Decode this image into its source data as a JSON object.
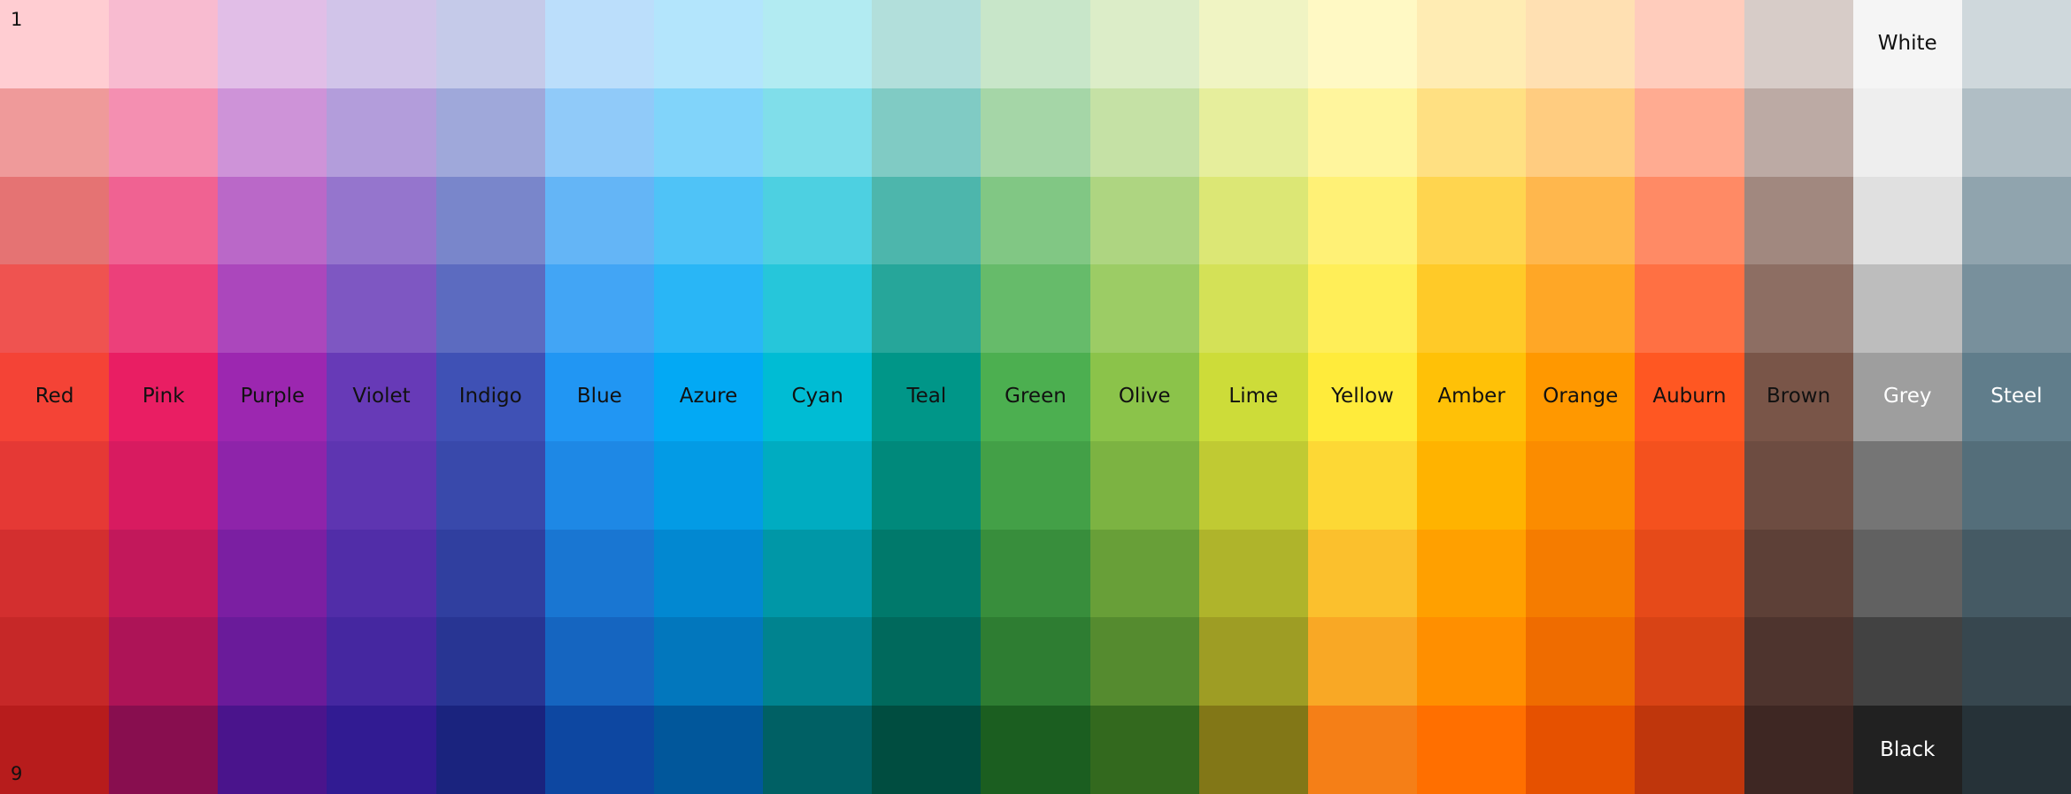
{
  "row_labels": {
    "first": "1",
    "last": "9"
  },
  "columns": [
    {
      "name": "Red",
      "label_row": 5,
      "label_color": "#111111",
      "shades": [
        "#FFCDD2",
        "#EF9A9A",
        "#E57373",
        "#EF5350",
        "#F44336",
        "#E53935",
        "#D32F2F",
        "#C62828",
        "#B71C1C"
      ]
    },
    {
      "name": "Pink",
      "label_row": 5,
      "label_color": "#111111",
      "shades": [
        "#F8BBD0",
        "#F48FB1",
        "#F06292",
        "#EC407A",
        "#E91E63",
        "#D81B60",
        "#C2185B",
        "#AD1457",
        "#880E4F"
      ]
    },
    {
      "name": "Purple",
      "label_row": 5,
      "label_color": "#111111",
      "shades": [
        "#E1BEE7",
        "#CE93D8",
        "#BA68C8",
        "#AB47BC",
        "#9C27B0",
        "#8E24AA",
        "#7B1FA2",
        "#6A1B9A",
        "#4A148C"
      ]
    },
    {
      "name": "Violet",
      "label_row": 5,
      "label_color": "#111111",
      "shades": [
        "#D1C4E9",
        "#B39DDB",
        "#9575CD",
        "#7E57C2",
        "#673AB7",
        "#5E35B1",
        "#512DA8",
        "#4527A0",
        "#311B92"
      ]
    },
    {
      "name": "Indigo",
      "label_row": 5,
      "label_color": "#111111",
      "shades": [
        "#C5CAE9",
        "#9FA8DA",
        "#7986CB",
        "#5C6BC0",
        "#3F51B5",
        "#3949AB",
        "#303F9F",
        "#283593",
        "#1A237E"
      ]
    },
    {
      "name": "Blue",
      "label_row": 5,
      "label_color": "#111111",
      "shades": [
        "#BBDEFB",
        "#90CAF9",
        "#64B5F6",
        "#42A5F5",
        "#2196F3",
        "#1E88E5",
        "#1976D2",
        "#1565C0",
        "#0D47A1"
      ]
    },
    {
      "name": "Azure",
      "label_row": 5,
      "label_color": "#111111",
      "shades": [
        "#B3E5FC",
        "#81D4FA",
        "#4FC3F7",
        "#29B6F6",
        "#03A9F4",
        "#039BE5",
        "#0288D1",
        "#0277BD",
        "#01579B"
      ]
    },
    {
      "name": "Cyan",
      "label_row": 5,
      "label_color": "#111111",
      "shades": [
        "#B2EBF2",
        "#80DEEA",
        "#4DD0E1",
        "#26C6DA",
        "#00BCD4",
        "#00ACC1",
        "#0097A7",
        "#00838F",
        "#006064"
      ]
    },
    {
      "name": "Teal",
      "label_row": 5,
      "label_color": "#111111",
      "shades": [
        "#B2DFDB",
        "#80CBC4",
        "#4DB6AC",
        "#26A69A",
        "#009688",
        "#00897B",
        "#00796B",
        "#00695C",
        "#004D40"
      ]
    },
    {
      "name": "Green",
      "label_row": 5,
      "label_color": "#111111",
      "shades": [
        "#C8E6C9",
        "#A5D6A7",
        "#81C784",
        "#66BB6A",
        "#4CAF50",
        "#43A047",
        "#388E3C",
        "#2E7D32",
        "#1B5E20"
      ]
    },
    {
      "name": "Olive",
      "label_row": 5,
      "label_color": "#111111",
      "shades": [
        "#DCEDC8",
        "#C5E1A5",
        "#AED581",
        "#9CCC65",
        "#8BC34A",
        "#7CB342",
        "#689F38",
        "#558B2F",
        "#33691E"
      ]
    },
    {
      "name": "Lime",
      "label_row": 5,
      "label_color": "#111111",
      "shades": [
        "#F0F4C3",
        "#E6EE9C",
        "#DCE775",
        "#D4E157",
        "#CDDC39",
        "#C0CA33",
        "#AFB42B",
        "#9E9D24",
        "#827717"
      ]
    },
    {
      "name": "Yellow",
      "label_row": 5,
      "label_color": "#111111",
      "shades": [
        "#FFF9C4",
        "#FFF59D",
        "#FFF176",
        "#FFEE58",
        "#FFEB3B",
        "#FDD835",
        "#FBC02D",
        "#F9A825",
        "#F57F17"
      ]
    },
    {
      "name": "Amber",
      "label_row": 5,
      "label_color": "#111111",
      "shades": [
        "#FFECB3",
        "#FFE082",
        "#FFD54F",
        "#FFCA28",
        "#FFC107",
        "#FFB300",
        "#FFA000",
        "#FF8F00",
        "#FF6F00"
      ]
    },
    {
      "name": "Orange",
      "label_row": 5,
      "label_color": "#111111",
      "shades": [
        "#FFE0B2",
        "#FFCC80",
        "#FFB74D",
        "#FFA726",
        "#FF9800",
        "#FB8C00",
        "#F57C00",
        "#EF6C00",
        "#E65100"
      ]
    },
    {
      "name": "Auburn",
      "label_row": 5,
      "label_color": "#111111",
      "shades": [
        "#FFCCBC",
        "#FFAB91",
        "#FF8A65",
        "#FF7043",
        "#FF5722",
        "#F4511E",
        "#E64A19",
        "#D84315",
        "#BF360C"
      ]
    },
    {
      "name": "Brown",
      "label_row": 5,
      "label_color": "#111111",
      "shades": [
        "#D7CCC8",
        "#BCAAA4",
        "#A1887F",
        "#8D6E63",
        "#795548",
        "#6D4C41",
        "#5D4037",
        "#4E342E",
        "#3E2723"
      ]
    },
    {
      "name": "Grey",
      "label_row": 5,
      "label_color": "#ffffff",
      "shades": [
        "#F5F5F5",
        "#EEEEEE",
        "#E0E0E0",
        "#BDBDBD",
        "#9E9E9E",
        "#757575",
        "#616161",
        "#424242",
        "#212121"
      ],
      "extra_labels": [
        {
          "text": "White",
          "row": 1,
          "color": "#111111"
        },
        {
          "text": "Black",
          "row": 9,
          "color": "#ffffff"
        }
      ]
    },
    {
      "name": "Steel",
      "label_row": 5,
      "label_color": "#ffffff",
      "shades": [
        "#CFD8DC",
        "#B0BEC5",
        "#90A4AE",
        "#78909C",
        "#607D8B",
        "#546E7A",
        "#455A64",
        "#37474F",
        "#263238"
      ]
    }
  ]
}
